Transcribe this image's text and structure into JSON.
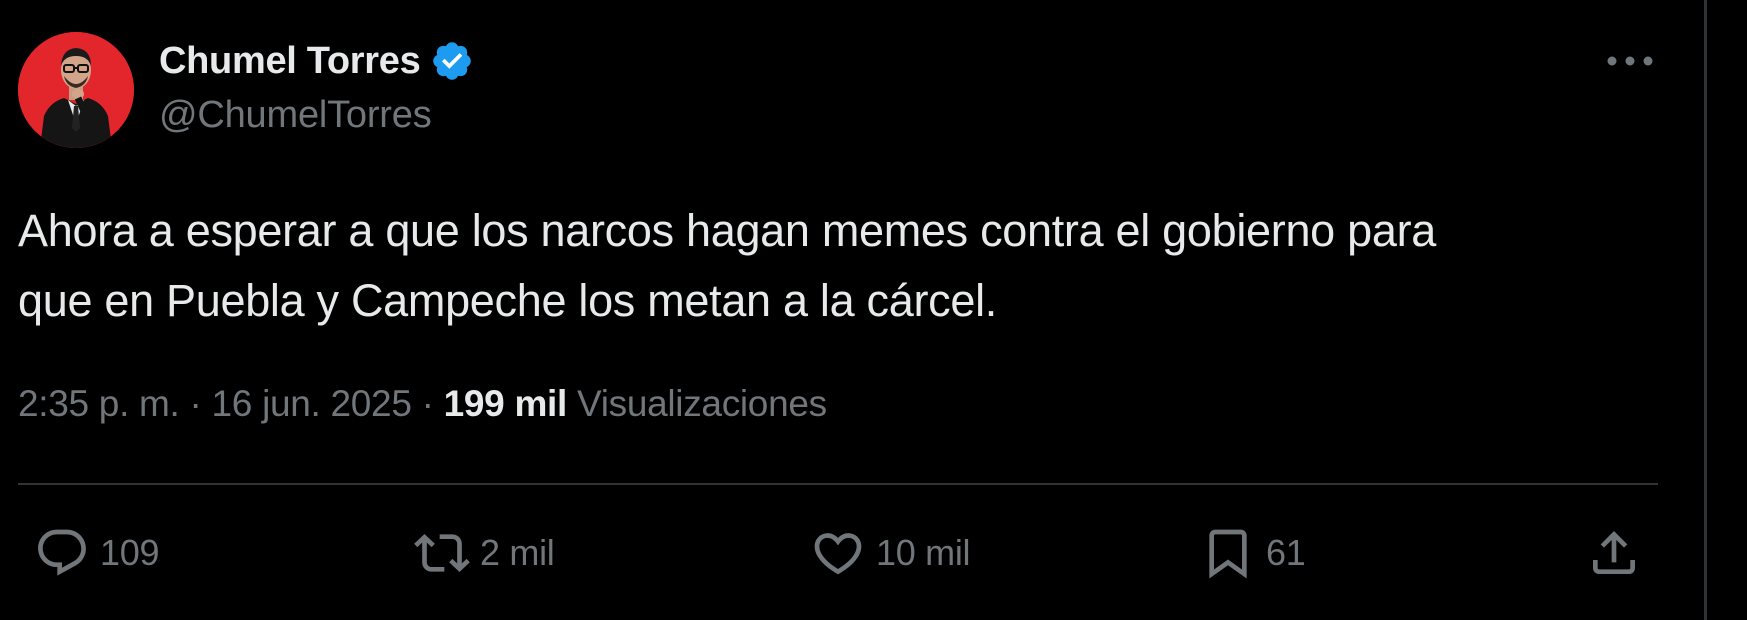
{
  "tweet": {
    "display_name": "Chumel Torres",
    "handle": "@ChumelTorres",
    "text_line1": "Ahora a esperar a que los narcos hagan memes contra el gobierno para",
    "text_line2": "que en Puebla y Campeche los metan a la cárcel.",
    "time": "2:35 p. m.",
    "separator": "·",
    "date": "16 jun. 2025",
    "views_count": "199 mil",
    "views_label": "Visualizaciones"
  },
  "actions": {
    "replies": "109",
    "reposts": "2 mil",
    "likes": "10 mil",
    "bookmarks": "61"
  },
  "icons": {
    "verified": "verified-badge-icon",
    "more": "more-horizontal-icon",
    "reply": "reply-bubble-icon",
    "repost": "repost-arrows-icon",
    "like": "heart-icon",
    "bookmark": "bookmark-icon",
    "share": "share-upload-icon"
  },
  "colors": {
    "background": "#000000",
    "primary_text": "#e7e9ea",
    "secondary_text": "#71767b",
    "verified_blue": "#1d9bf0",
    "avatar_red": "#e3262c",
    "divider": "#2f3336"
  }
}
